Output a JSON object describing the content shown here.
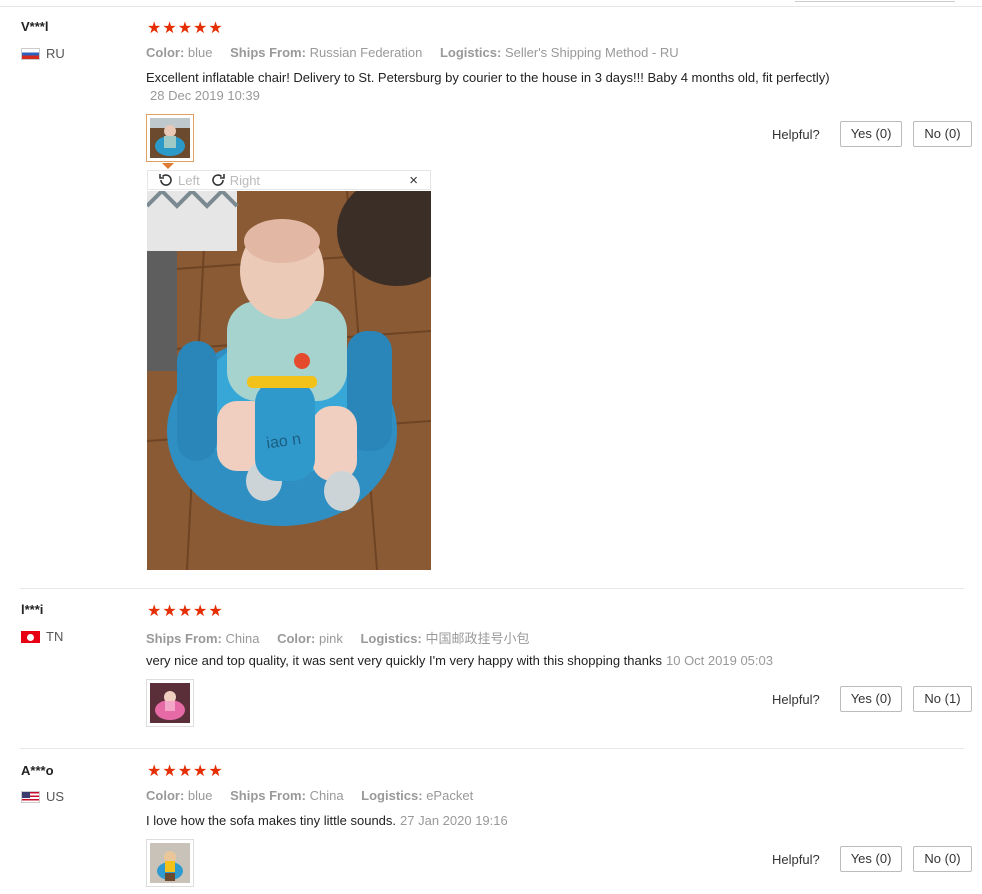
{
  "reviews": [
    {
      "user": "V***l",
      "country": "RU",
      "stars": "★★★★★",
      "meta": [
        {
          "label": "Color:",
          "value": "blue"
        },
        {
          "label": "Ships From:",
          "value": "Russian Federation"
        },
        {
          "label": "Logistics:",
          "value": "Seller's Shipping Method - RU"
        }
      ],
      "text": "Excellent inflatable chair! Delivery to St. Petersburg by courier to the house in 3 days!!! Baby 4 months old, fit perfectly)",
      "date": "28 Dec 2019 10:39",
      "helpful_label": "Helpful?",
      "yes": "Yes (0)",
      "no": "No (0)"
    },
    {
      "user": "l***i",
      "country": "TN",
      "stars": "★★★★★",
      "meta": [
        {
          "label": "Ships From:",
          "value": "China"
        },
        {
          "label": "Color:",
          "value": "pink"
        },
        {
          "label": "Logistics:",
          "value": "中国邮政挂号小包"
        }
      ],
      "text": "very nice and top quality, it was sent very quickly I'm very happy with this shopping thanks",
      "date": "10 Oct 2019 05:03",
      "helpful_label": "Helpful?",
      "yes": "Yes (0)",
      "no": "No (1)"
    },
    {
      "user": "A***o",
      "country": "US",
      "stars": "★★★★★",
      "meta": [
        {
          "label": "Color:",
          "value": "blue"
        },
        {
          "label": "Ships From:",
          "value": "China"
        },
        {
          "label": "Logistics:",
          "value": "ePacket"
        }
      ],
      "text": "I love how the sofa makes tiny little sounds.",
      "date": "27 Jan 2020 19:16",
      "helpful_label": "Helpful?",
      "yes": "Yes (0)",
      "no": "No (0)"
    }
  ],
  "viewer": {
    "left_label": "Left",
    "right_label": "Right",
    "close": "×"
  },
  "colors": {
    "star": "#e62e04",
    "muted": "#999999"
  }
}
